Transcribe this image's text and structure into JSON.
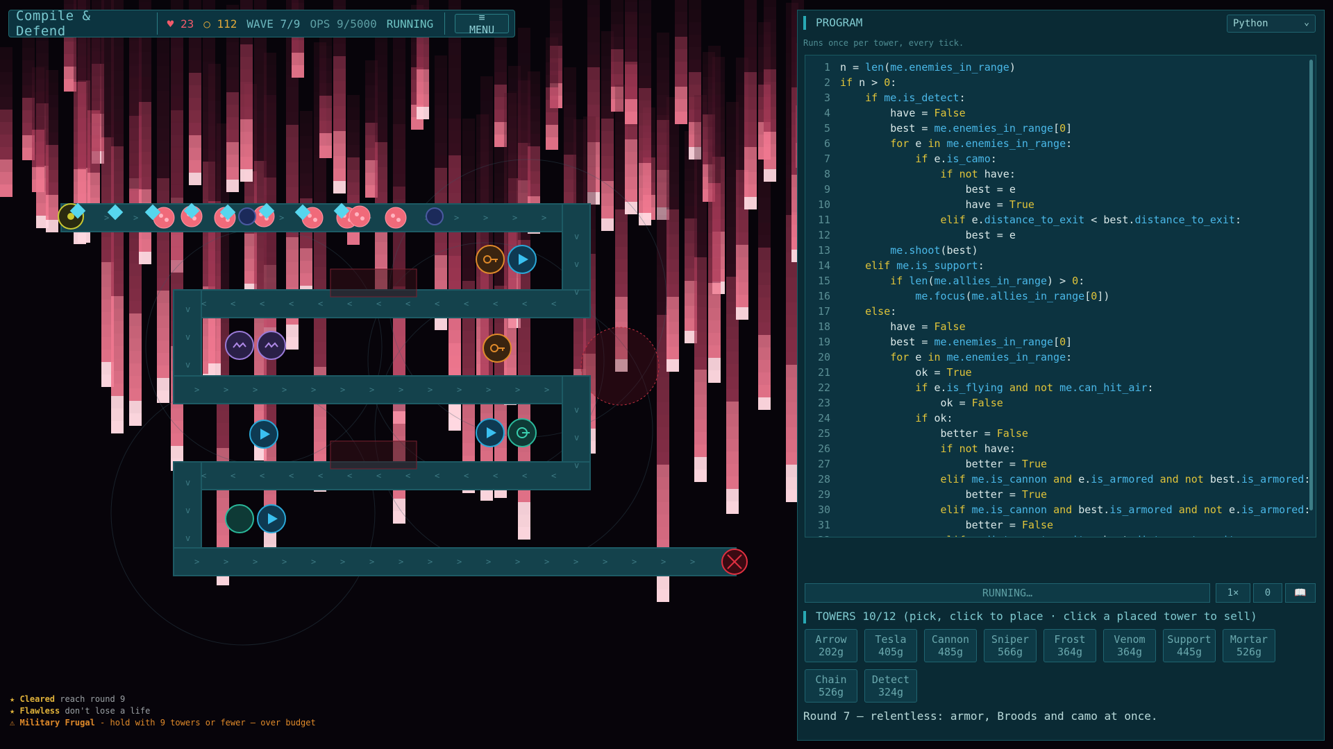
{
  "hud": {
    "title": "Compile & Defend",
    "lives": "♥ 23",
    "gold": "○ 112",
    "wave": "WAVE 7/9",
    "ops": "OPS 9/5000",
    "state": "RUNNING",
    "menu_label": "≡ MENU"
  },
  "program": {
    "title": "PROGRAM",
    "language": "Python",
    "subtitle": "Runs once per tower, every tick.",
    "lines": [
      "n = len(me.enemies_in_range)",
      "if n > 0:",
      "    if me.is_detect:",
      "        have = False",
      "        best = me.enemies_in_range[0]",
      "        for e in me.enemies_in_range:",
      "            if e.is_camo:",
      "                if not have:",
      "                    best = e",
      "                    have = True",
      "                elif e.distance_to_exit < best.distance_to_exit:",
      "                    best = e",
      "        me.shoot(best)",
      "    elif me.is_support:",
      "        if len(me.allies_in_range) > 0:",
      "            me.focus(me.allies_in_range[0])",
      "    else:",
      "        have = False",
      "        best = me.enemies_in_range[0]",
      "        for e in me.enemies_in_range:",
      "            ok = True",
      "            if e.is_flying and not me.can_hit_air:",
      "                ok = False",
      "            if ok:",
      "                better = False",
      "                if not have:",
      "                    better = True",
      "                elif me.is_cannon and e.is_armored and not best.is_armored:",
      "                    better = True",
      "                elif me.is_cannon and best.is_armored and not e.is_armored:",
      "                    better = False",
      "                elif e.distance_to_exit < best.distance_to_exit:"
    ]
  },
  "controls": {
    "run_label": "RUNNING…",
    "speed_label": "1×",
    "reset_label": "0",
    "book_label": "📖"
  },
  "towers": {
    "heading": "TOWERS   10/12  (pick, click to place · click a placed tower to sell)",
    "items": [
      {
        "name": "Arrow",
        "cost": "202g"
      },
      {
        "name": "Tesla",
        "cost": "405g"
      },
      {
        "name": "Cannon",
        "cost": "485g"
      },
      {
        "name": "Sniper",
        "cost": "566g"
      },
      {
        "name": "Frost",
        "cost": "364g"
      },
      {
        "name": "Venom",
        "cost": "364g"
      },
      {
        "name": "Support",
        "cost": "445g"
      },
      {
        "name": "Mortar",
        "cost": "526g"
      },
      {
        "name": "Chain",
        "cost": "526g"
      },
      {
        "name": "Detect",
        "cost": "324g"
      }
    ]
  },
  "round_text": "Round 7 — relentless: armor, Broods and camo at once.",
  "achievements": [
    {
      "star": "★ Cleared",
      "text": " reach round 9",
      "color": "#e0b23a"
    },
    {
      "star": "★ Flawless",
      "text": " don't lose a life",
      "color": "#e0b23a"
    },
    {
      "star": "⚠ Military Frugal",
      "text": " - hold with 9 towers or fewer — over budget",
      "color": "#e08a2a"
    }
  ],
  "colors": {
    "accent": "#28a9b4",
    "path": "#14424c",
    "enemy": "#f06a7a",
    "camo": "#57d6ee",
    "rain": "#f07890"
  }
}
